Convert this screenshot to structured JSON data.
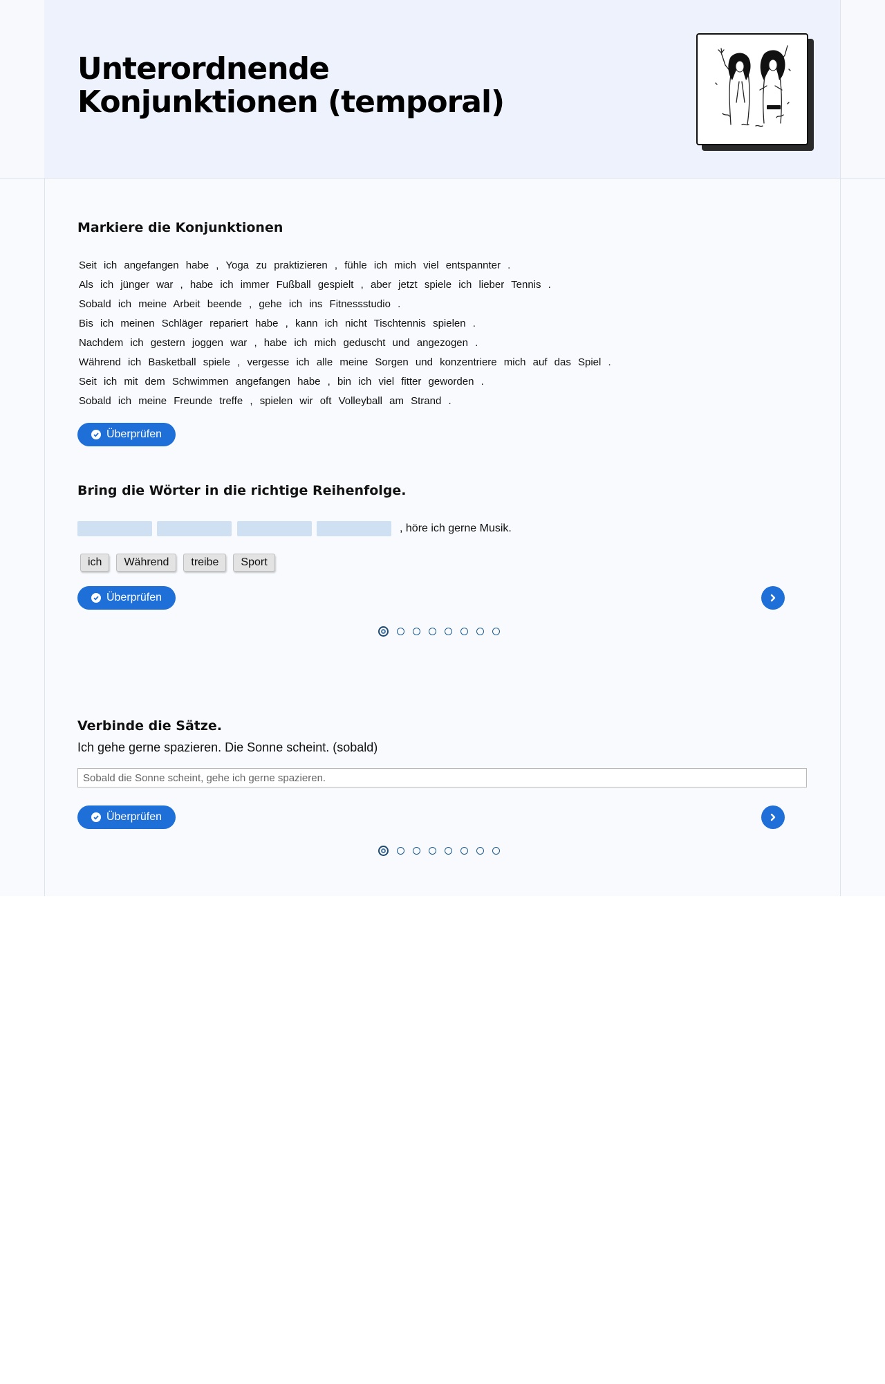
{
  "header": {
    "title_line1": "Unterordnende",
    "title_line2": "Konjunktionen (temporal)"
  },
  "exercise1": {
    "title": "Markiere die Konjunktionen",
    "sentences": [
      "Seit ich angefangen habe , Yoga zu praktizieren , fühle ich mich viel entspannter .",
      "Als ich jünger war , habe ich immer Fußball gespielt , aber jetzt spiele ich lieber Tennis .",
      "Sobald ich meine Arbeit beende , gehe ich ins Fitnessstudio .",
      "Bis ich meinen Schläger repariert habe , kann ich nicht Tischtennis spielen .",
      "Nachdem ich gestern joggen war , habe ich mich geduscht und angezogen .",
      "Während ich Basketball spiele , vergesse ich alle meine Sorgen und konzentriere mich auf das Spiel .",
      "Seit ich mit dem Schwimmen angefangen habe , bin ich viel fitter geworden .",
      "Sobald ich meine Freunde treffe , spielen wir oft Volleyball am Strand ."
    ],
    "check_label": "Überprüfen"
  },
  "exercise2": {
    "title": "Bring die Wörter in die richtige Reihenfolge.",
    "sentence_rest": ", höre ich gerne Musik.",
    "words": [
      "ich",
      "Während",
      "treibe",
      "Sport"
    ],
    "check_label": "Überprüfen",
    "pages": 8,
    "current_page": 1
  },
  "exercise3": {
    "title": "Verbinde die Sätze.",
    "prompt": "Ich gehe gerne spazieren. Die Sonne scheint. (sobald)",
    "answer_value": "Sobald die Sonne scheint, gehe ich gerne spazieren.",
    "check_label": "Überprüfen",
    "pages": 8,
    "current_page": 1
  },
  "colors": {
    "accent": "#1f6fd8",
    "header_bg": "#edf2fd",
    "slot_bg": "#cfe0f3"
  },
  "icons": [
    "illustration-two-women",
    "check-circle-icon",
    "chevron-right-icon"
  ]
}
